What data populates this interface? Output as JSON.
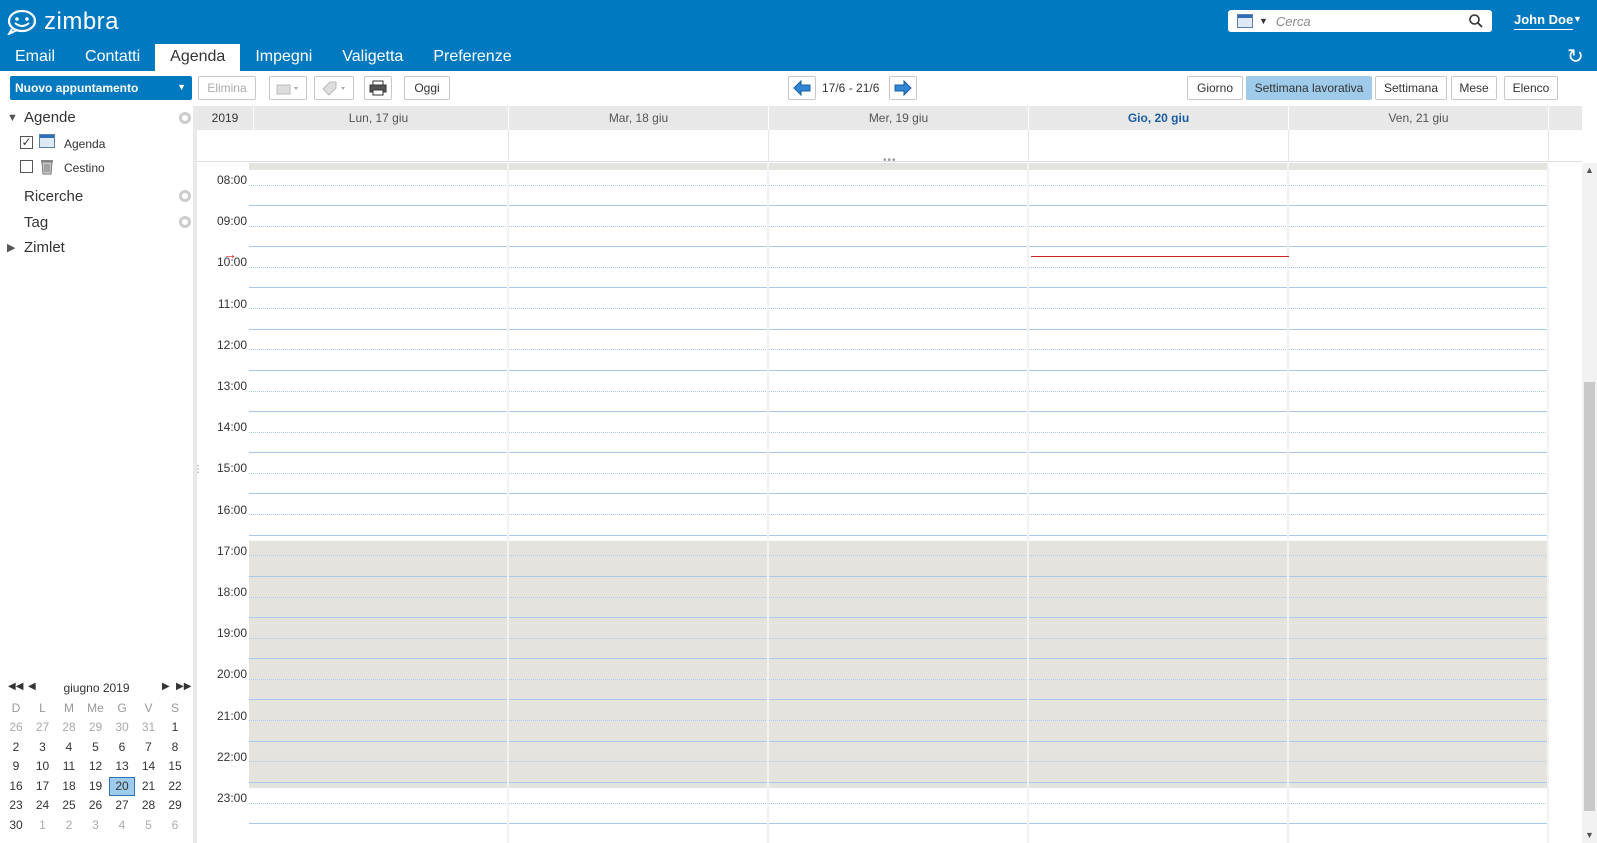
{
  "app": {
    "logo_text": "zimbra"
  },
  "search": {
    "placeholder": "Cerca"
  },
  "user": {
    "name": "John Doe"
  },
  "tabs": [
    "Email",
    "Contatti",
    "Agenda",
    "Impegni",
    "Valigetta",
    "Preferenze"
  ],
  "active_tab": "Agenda",
  "toolbar": {
    "new_appointment": "Nuovo appuntamento",
    "delete": "Elimina",
    "today": "Oggi",
    "date_range": "17/6 - 21/6",
    "views": [
      "Giorno",
      "Settimana lavorativa",
      "Settimana",
      "Mese",
      "Elenco"
    ],
    "active_view": "Settimana lavorativa"
  },
  "sidebar": {
    "calendars_header": "Agende",
    "calendars": [
      {
        "label": "Agenda",
        "checked": true
      },
      {
        "label": "Cestino",
        "checked": false
      }
    ],
    "searches": "Ricerche",
    "tags": "Tag",
    "zimlets": "Zimlet"
  },
  "minical": {
    "title": "giugno 2019",
    "dow": [
      "D",
      "L",
      "M",
      "Me",
      "G",
      "V",
      "S"
    ],
    "weeks": [
      [
        "26",
        "27",
        "28",
        "29",
        "30",
        "31",
        "1"
      ],
      [
        "2",
        "3",
        "4",
        "5",
        "6",
        "7",
        "8"
      ],
      [
        "9",
        "10",
        "11",
        "12",
        "13",
        "14",
        "15"
      ],
      [
        "16",
        "17",
        "18",
        "19",
        "20",
        "21",
        "22"
      ],
      [
        "23",
        "24",
        "25",
        "26",
        "27",
        "28",
        "29"
      ],
      [
        "30",
        "1",
        "2",
        "3",
        "4",
        "5",
        "6"
      ]
    ],
    "today": "20"
  },
  "calendar": {
    "year": "2019",
    "days": [
      "Lun, 17 giu",
      "Mar, 18 giu",
      "Mer, 19 giu",
      "Gio, 20 giu",
      "Ven, 21 giu"
    ],
    "today_day": "Gio, 20 giu",
    "hours": [
      "08:00",
      "09:00",
      "10:00",
      "11:00",
      "12:00",
      "13:00",
      "14:00",
      "15:00",
      "16:00",
      "17:00",
      "18:00",
      "19:00",
      "20:00",
      "21:00",
      "22:00",
      "23:00"
    ],
    "working_hours": "09:00 - 18:00",
    "current_time": "09:08",
    "colors": {
      "brand": "#0079c1",
      "off_hours": "#e4e3de",
      "grid_line": "#aac8ec",
      "now": "#cc2222"
    }
  }
}
